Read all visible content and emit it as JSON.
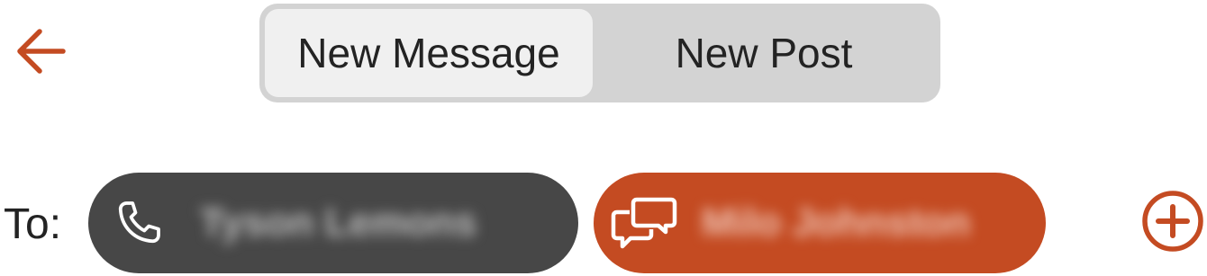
{
  "header": {
    "back_icon": "arrow-left-icon",
    "tabs": [
      {
        "label": "New Message",
        "selected": true
      },
      {
        "label": "New Post",
        "selected": false
      }
    ]
  },
  "recipients": {
    "label": "To:",
    "chips": [
      {
        "type": "phone",
        "icon": "phone-icon",
        "name": "Tyson Lemons",
        "name_blurred": true
      },
      {
        "type": "chat",
        "icon": "chat-bubbles-icon",
        "name": "Milo Johnston",
        "name_blurred": true
      }
    ],
    "add_icon": "plus-circle-icon"
  },
  "colors": {
    "accent": "#c44b22",
    "phone_chip": "#474747",
    "segmented_bg": "#d3d3d3",
    "segment_active_bg": "#f0f0f0",
    "text": "#232323"
  }
}
